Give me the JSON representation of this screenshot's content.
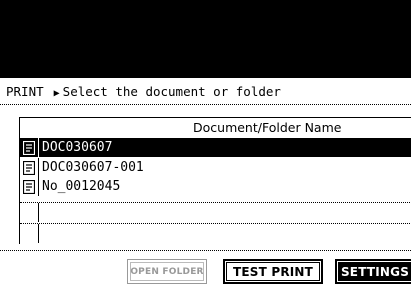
{
  "header": {
    "mode": "PRINT",
    "instruction": "Select the document or folder"
  },
  "table": {
    "column_header": "Document/Folder Name",
    "rows": [
      {
        "name": "DOC030607",
        "selected": true,
        "icon": "document-icon"
      },
      {
        "name": "DOC030607-001",
        "selected": false,
        "icon": "document-icon"
      },
      {
        "name": "No_0012045",
        "selected": false,
        "icon": "document-icon"
      }
    ]
  },
  "buttons": {
    "open_folder": "OPEN FOLDER",
    "test_print": "TEST PRINT",
    "settings": "SETTINGS"
  }
}
